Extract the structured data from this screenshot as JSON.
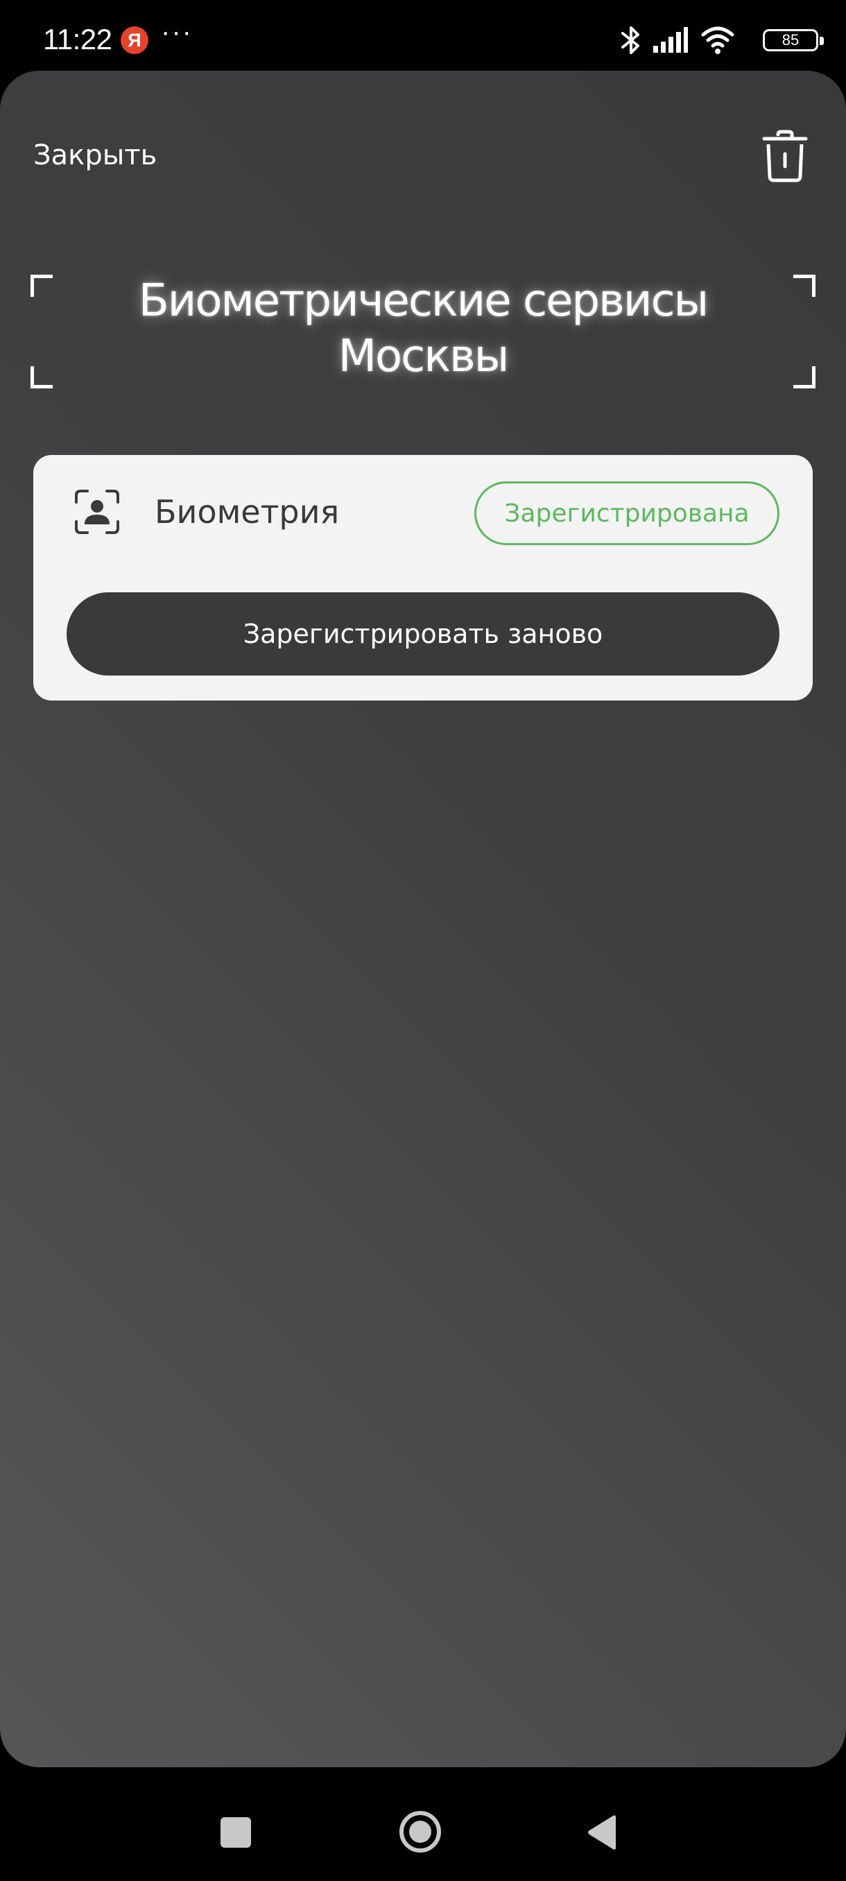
{
  "status_bar": {
    "time": "11:22",
    "yandex_badge": "Я",
    "more": "···",
    "battery_level": "85",
    "icons": [
      "bluetooth-icon",
      "signal-icon",
      "wifi-icon",
      "battery-icon"
    ]
  },
  "header": {
    "close_label": "Закрыть",
    "delete_icon": "trash-icon"
  },
  "title": {
    "line1": "Биометрические сервисы",
    "line2": "Москвы"
  },
  "biometry_card": {
    "icon": "face-scan-icon",
    "label": "Биометрия",
    "status": "Зарегистрирована",
    "status_color": "#5cb85c",
    "button_label": "Зарегистрировать заново"
  },
  "nav_bar": {
    "buttons": [
      "recents-icon",
      "home-icon",
      "back-icon"
    ]
  }
}
